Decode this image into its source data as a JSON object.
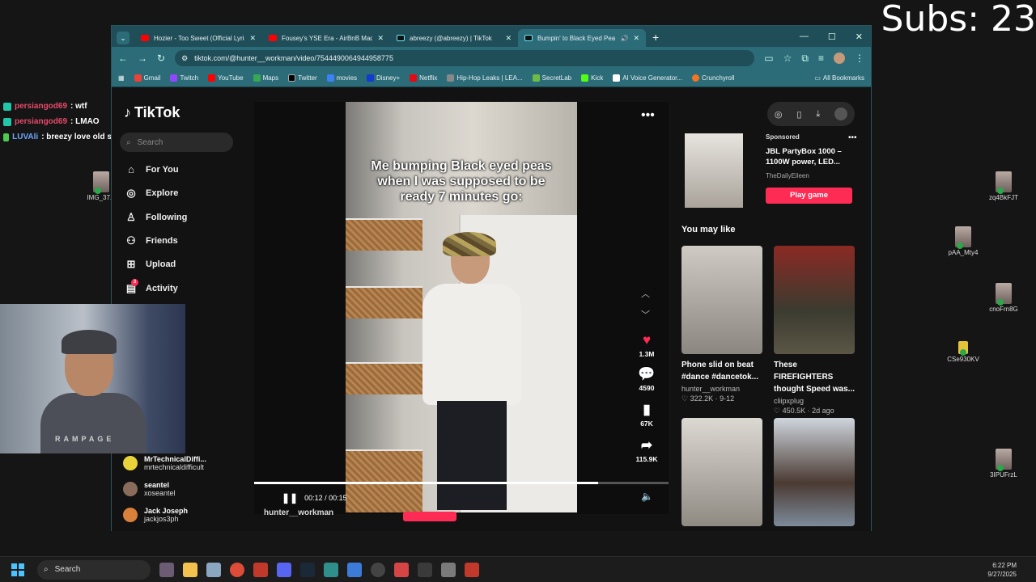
{
  "overlay": {
    "subs": "Subs: 23",
    "chat": [
      {
        "user": "persiangod69",
        "msg": ": wtf"
      },
      {
        "user": "persiangod69",
        "msg": ": LMAO"
      },
      {
        "user": "LUVAli",
        "msg": ": breezy love old stuff"
      }
    ],
    "webcam_shirt_text": "RAMPAGE"
  },
  "desktop_icons_left": [
    {
      "label": "IMG_37..."
    }
  ],
  "desktop_icons_right": [
    {
      "label": "zq4BkFJT"
    },
    {
      "label": "pAA_Mty4"
    },
    {
      "label": "cnoFrn8G"
    },
    {
      "label": "CSe930KV"
    },
    {
      "label": "3IPUFrzL"
    }
  ],
  "browser": {
    "tabs": [
      {
        "title": "Hozier - Too Sweet (Official Lyric",
        "color": "#ff0000"
      },
      {
        "title": "Fousey's YSE Era - AirBnB Madn",
        "color": "#ff0000"
      },
      {
        "title": "abreezy (@abreezy) | TikTok",
        "color": "#111111"
      },
      {
        "title": "Bumpin' to Black Eyed Peas",
        "color": "#111111"
      }
    ],
    "url": "tiktok.com/@hunter__workman/video/7544490064944958775",
    "bookmarks": [
      "Gmail",
      "Twitch",
      "YouTube",
      "Maps",
      "Twitter",
      "movies",
      "Disney+",
      "Netflix",
      "Hip-Hop Leaks | LEA...",
      "SecretLab",
      "Kick",
      "AI Voice Generator...",
      "Crunchyroll"
    ],
    "all_bookmarks": "All Bookmarks"
  },
  "tiktok": {
    "logo": "TikTok",
    "search_placeholder": "Search",
    "nav": [
      "For You",
      "Explore",
      "Following",
      "Friends",
      "Upload",
      "Activity"
    ],
    "activity_badge": "3",
    "following_accounts": [
      {
        "name": "MrTechnicalDiffi...",
        "handle": "mrtechnicaldifficult"
      },
      {
        "name": "seantel",
        "handle": "xoseantel"
      },
      {
        "name": "Jack Joseph",
        "handle": "jackjos3ph"
      }
    ],
    "video": {
      "caption": "Me bumping Black eyed peas when I was supposed to be ready 7 minutes go:",
      "time_current": "00:12",
      "time_total": "00:15",
      "progress": 0.83,
      "likes": "1.3M",
      "comments": "4590",
      "saves": "67K",
      "shares": "115.9K",
      "author": "hunter__workman"
    },
    "ad": {
      "sponsored": "Sponsored",
      "title": "JBL PartyBox 1000 – 1100W power, LED...",
      "advertiser": "TheDailyEileen",
      "button": "Play game"
    },
    "you_may_like": "You may like",
    "suggestions": [
      {
        "title": "Phone slid on beat #dance #dancetok...",
        "user": "hunter__workman",
        "stats": "♡ 322.2K · 9-12"
      },
      {
        "title": "These FIREFIGHTERS thought Speed was...",
        "user": "cliipxplug",
        "stats": "♡ 450.5K · 2d ago"
      },
      {
        "title": "",
        "user": "",
        "stats": ""
      },
      {
        "title": "",
        "user": "",
        "stats": ""
      }
    ]
  },
  "taskbar": {
    "search": "Search",
    "time": "6:22 PM",
    "date": "9/27/2025"
  }
}
